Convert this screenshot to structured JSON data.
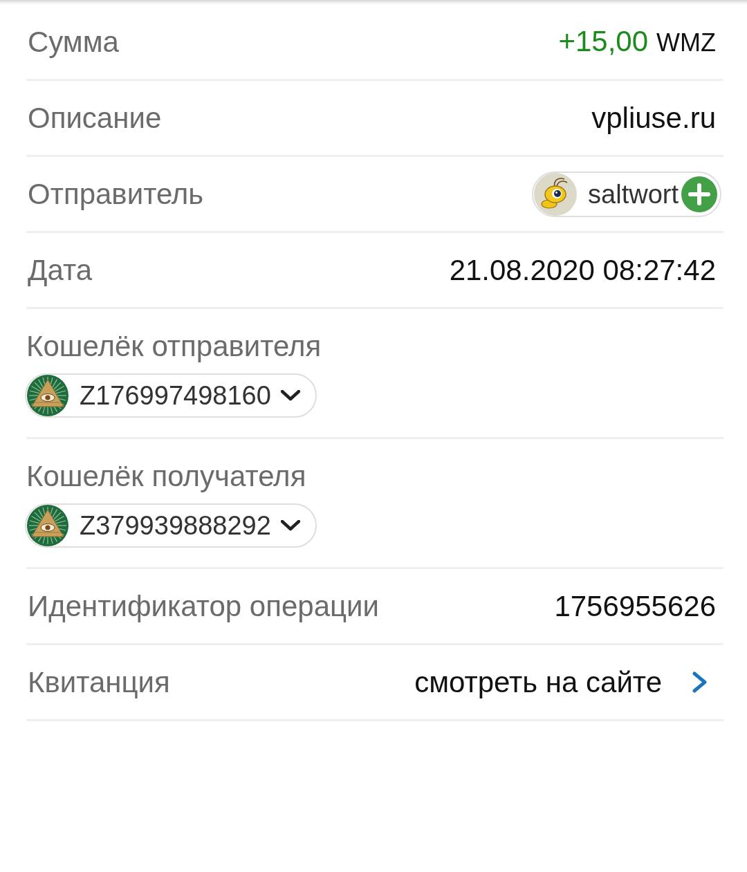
{
  "rows": [
    {
      "kind": "amount",
      "label": "Сумма",
      "amount": "+15,00",
      "currency": "WMZ"
    },
    {
      "kind": "text",
      "label": "Описание",
      "value": "vpliuse.ru"
    },
    {
      "kind": "contact",
      "label": "Отправитель",
      "name": "saltwort"
    },
    {
      "kind": "text",
      "label": "Дата",
      "value": "21.08.2020 08:27:42"
    },
    {
      "kind": "wallet",
      "label": "Кошелёк отправителя",
      "wallet": "Z176997498160"
    },
    {
      "kind": "wallet",
      "label": "Кошелёк получателя",
      "wallet": "Z379939888292"
    },
    {
      "kind": "text",
      "label": "Идентификатор операции",
      "value": "1756955626"
    },
    {
      "kind": "link",
      "label": "Квитанция",
      "link": "смотреть на сайте"
    }
  ]
}
